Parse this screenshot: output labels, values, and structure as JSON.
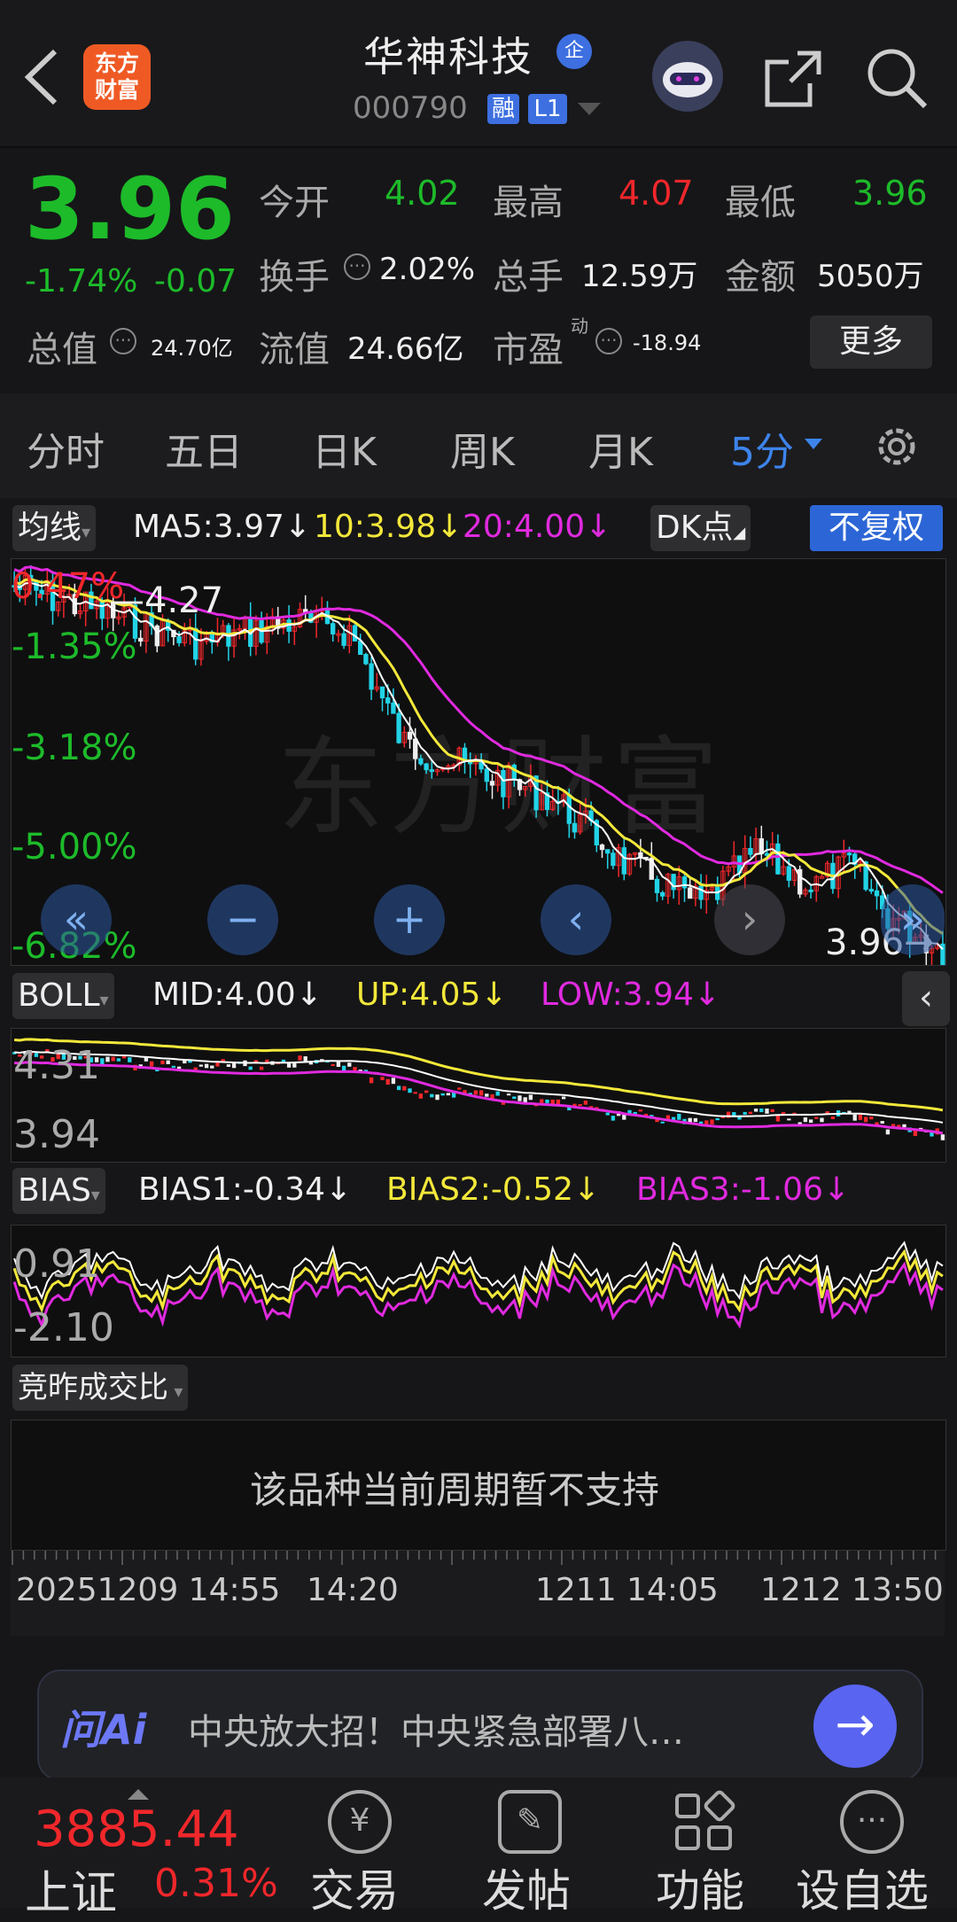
{
  "header": {
    "logo_text_1": "东方",
    "logo_text_2": "财富",
    "stock_name": "华神科技",
    "verified_badge": "企",
    "stock_code": "000790",
    "tag_margin": "融",
    "tag_level": "L1"
  },
  "quote": {
    "price": "3.96",
    "change_pct": "-1.74%",
    "change_amt": "-0.07",
    "open_label": "今开",
    "open_value": "4.02",
    "high_label": "最高",
    "high_value": "4.07",
    "low_label": "最低",
    "low_value": "3.96",
    "turnover_label": "换手",
    "turnover_value": "2.02%",
    "volume_label": "总手",
    "volume_value": "12.59万",
    "amount_label": "金额",
    "amount_value": "5050万",
    "mktcap_label": "总值",
    "mktcap_value": "24.70亿",
    "float_label": "流值",
    "float_value": "24.66亿",
    "pe_label": "市盈",
    "pe_sup": "动",
    "pe_value": "-18.94",
    "more_label": "更多"
  },
  "tabs": [
    "分时",
    "五日",
    "日K",
    "周K",
    "月K",
    "5分"
  ],
  "ma": {
    "selector": "均线",
    "ma5": "MA5:3.97",
    "ma10": "10:3.98",
    "ma20": "20:4.00",
    "dk_label": "DK点",
    "adjust_label": "不复权"
  },
  "main_chart": {
    "y_labels": [
      "0.47%",
      "-1.35%",
      "-3.18%",
      "-5.00%",
      "-6.82%"
    ],
    "high_marker": "4.27",
    "last_marker": "3.96",
    "watermark": "东方财富"
  },
  "boll": {
    "selector": "BOLL",
    "mid": "MID:4.00",
    "up": "UP:4.05",
    "low": "LOW:3.94",
    "y_top": "4.31",
    "y_bottom": "3.94"
  },
  "bias": {
    "selector": "BIAS",
    "bias1": "BIAS1:-0.34",
    "bias2": "BIAS2:-0.52",
    "bias3": "BIAS3:-1.06",
    "y_top": "0.91",
    "y_bottom": "-2.10"
  },
  "auction": {
    "selector": "竞昨成交比",
    "message": "该品种当前周期暂不支持"
  },
  "time_axis": {
    "start": "20251209 14:55",
    "t2": "14:20",
    "t3": "1211 14:05",
    "t4": "1212 13:50"
  },
  "ai": {
    "logo": "问Ai",
    "text": "中央放大招！中央紧急部署八…"
  },
  "bottom_nav": {
    "index_value": "3885.44",
    "index_name": "上证",
    "index_pct": "0.31%",
    "trade": "交易",
    "post": "发帖",
    "function": "功能",
    "watchlist": "设自选"
  },
  "colors": {
    "up": "#f0272b",
    "down": "#1dbb2a",
    "accent": "#3d84ec",
    "ma5": "#ffffff",
    "ma10": "#f3e83a",
    "ma20": "#e02adf"
  }
}
